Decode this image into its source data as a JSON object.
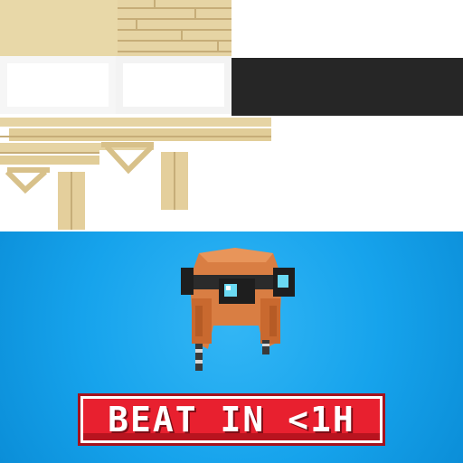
{
  "badge": {
    "text": "BEAT IN <1H",
    "color_face": "#e8202f",
    "color_edge": "#a5121d"
  },
  "colors": {
    "sky_top": "#33b6f5",
    "sky_bottom": "#0b8ed8",
    "wood": "#e6d5a7",
    "leather": "#d77a3f",
    "goggle_lens": "#66d7f2"
  },
  "icons": {
    "texture": "wood-plank-texture-sheet",
    "cosmetic": "aviator-cap-with-goggles-icon"
  }
}
